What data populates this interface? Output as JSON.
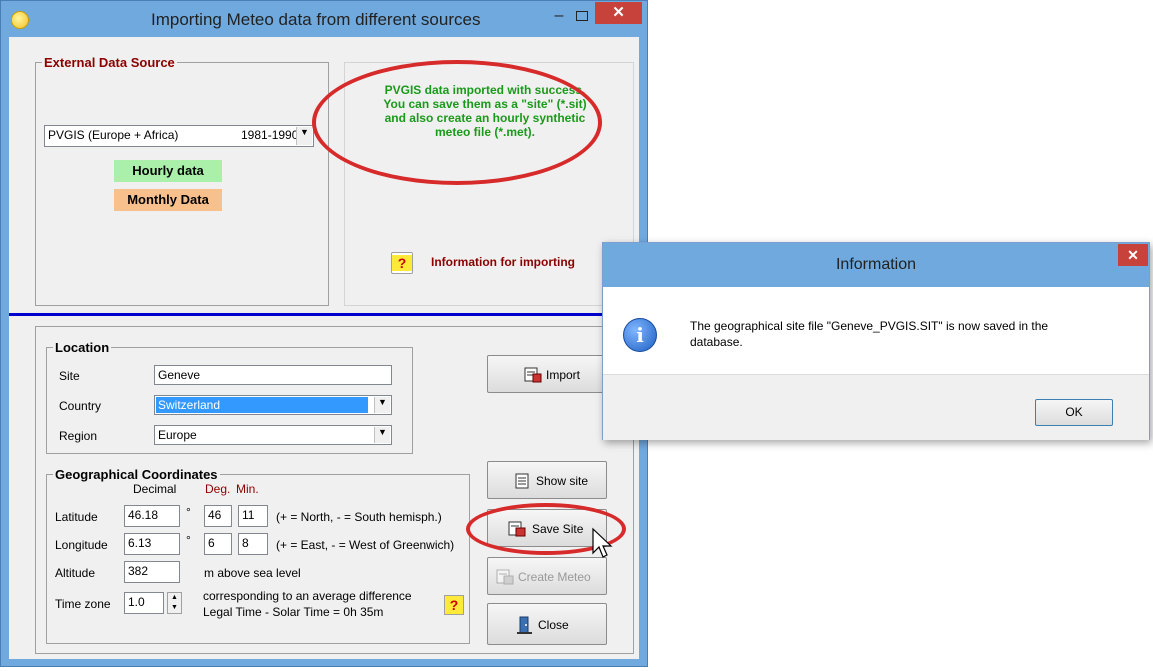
{
  "main_window": {
    "title": "Importing Meteo data from different sources",
    "min_glyph": "–",
    "close_glyph": "✕"
  },
  "external": {
    "group_title": "External Data Source",
    "source_select": "PVGIS  (Europe + Africa)",
    "source_years": "1981-1990",
    "hourly": "Hourly data",
    "monthly": "Monthly Data",
    "hourly_color": "#aaf0aa",
    "monthly_color": "#f8c08c"
  },
  "message": {
    "lines": [
      "PVGIS data imported with success.",
      "You can save them as a \"site\" (*.sit)",
      "and also create an hourly synthetic",
      "meteo file  (*.met)."
    ],
    "color": "#1a9a1a"
  },
  "info_btn": {
    "glyph": "?",
    "label": "Information for importing"
  },
  "location": {
    "group_title": "Location",
    "site_label": "Site",
    "site_value": "Geneve",
    "country_label": "Country",
    "country_value": "Switzerland",
    "region_label": "Region",
    "region_value": "Europe"
  },
  "coords": {
    "group_title": "Geographical Coordinates",
    "col_decimal": "Decimal",
    "col_deg": "Deg.",
    "col_min": "Min.",
    "latitude_label": "Latitude",
    "latitude_dec": "46.18",
    "latitude_deg": "46",
    "latitude_min": "11",
    "latitude_hint": "(+ = North,  - = South hemisph.)",
    "longitude_label": "Longitude",
    "longitude_dec": "6.13",
    "longitude_deg": "6",
    "longitude_min": "8",
    "longitude_hint": "(+ = East, - = West of Greenwich)",
    "degree": "°",
    "altitude_label": "Altitude",
    "altitude_value": "382",
    "altitude_unit": "m above sea level",
    "timezone_label": "Time zone",
    "timezone_value": "1.0",
    "timezone_note1": "corresponding to an average difference",
    "timezone_note2": "Legal Time - Solar Time =  0h 35m",
    "help_glyph": "?"
  },
  "buttons": {
    "import": "Import",
    "show_site": "Show site",
    "save_site": "Save Site",
    "create_meteo": "Create Meteo",
    "close": "Close"
  },
  "dialog": {
    "title": "Information",
    "close_glyph": "✕",
    "info_glyph": "i",
    "message_line1": "The geographical site file \"Geneve_PVGIS.SIT\" is now saved in the",
    "message_line2": "database.",
    "ok": "OK"
  },
  "colors": {
    "title_bar": "#6fa9de",
    "separator": "#0000cc",
    "highlight_oval": "#d72a2a",
    "selection": "#3399ff",
    "dark_red_text": "#8b0000"
  }
}
